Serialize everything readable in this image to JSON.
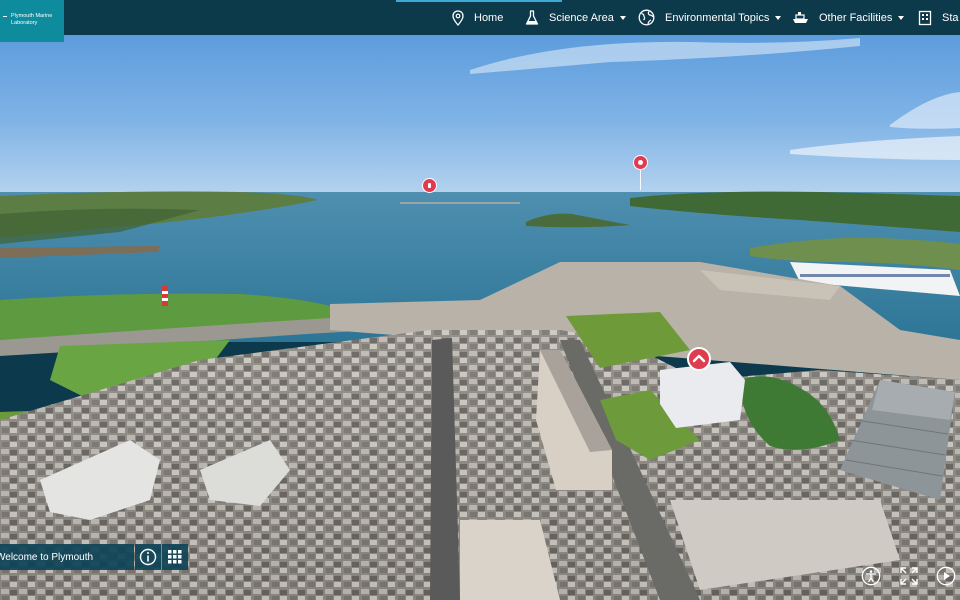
{
  "brand": {
    "line1": "Plymouth Marine",
    "line2": "Laboratory"
  },
  "nav": [
    {
      "label": "Home",
      "icon": "map-pin-icon",
      "dropdown": false
    },
    {
      "label": "Science Area",
      "icon": "flask-icon",
      "dropdown": true
    },
    {
      "label": "Environmental Topics",
      "icon": "globe-icon",
      "dropdown": true
    },
    {
      "label": "Other Facilities",
      "icon": "ship-icon",
      "dropdown": true
    },
    {
      "label": "Sta",
      "icon": "building-icon",
      "dropdown": false
    }
  ],
  "tour": {
    "welcome_text": "Welcome to Plymouth"
  },
  "colors": {
    "nav_bg": "#0d3a4b",
    "logo_bg": "#0e8b9c",
    "hotspot": "#e03c4f",
    "bar_bg": "#0e4458",
    "accent": "#3fa9d6"
  }
}
